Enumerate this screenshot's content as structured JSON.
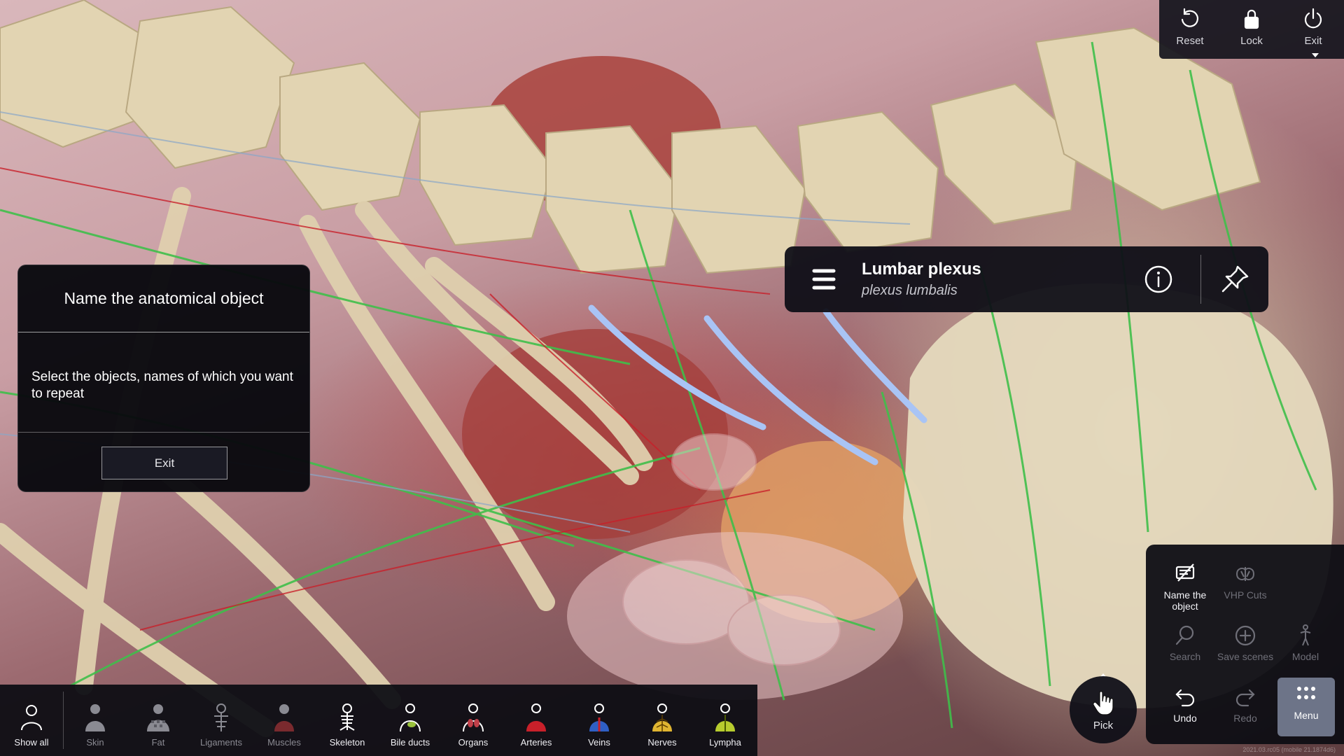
{
  "top_toolbar": {
    "reset_label": "Reset",
    "lock_label": "Lock",
    "exit_label": "Exit"
  },
  "quiz": {
    "title": "Name the anatomical object",
    "instruction": "Select the objects, names of which you want to repeat",
    "exit_label": "Exit"
  },
  "object_label": {
    "name": "Lumbar plexus",
    "latin": "plexus lumbalis"
  },
  "layers": [
    {
      "label": "Show all",
      "icon": "person-outline-icon",
      "state": "on"
    },
    {
      "label": "Skin",
      "icon": "skin-icon",
      "state": "dim"
    },
    {
      "label": "Fat",
      "icon": "fat-icon",
      "state": "dim"
    },
    {
      "label": "Ligaments",
      "icon": "ligaments-icon",
      "state": "dim"
    },
    {
      "label": "Muscles",
      "icon": "muscles-icon",
      "state": "dim"
    },
    {
      "label": "Skeleton",
      "icon": "skeleton-icon",
      "state": "on"
    },
    {
      "label": "Bile ducts",
      "icon": "bile-ducts-icon",
      "state": "on"
    },
    {
      "label": "Organs",
      "icon": "organs-icon",
      "state": "on"
    },
    {
      "label": "Arteries",
      "icon": "arteries-icon",
      "state": "on"
    },
    {
      "label": "Veins",
      "icon": "veins-icon",
      "state": "on"
    },
    {
      "label": "Nerves",
      "icon": "nerves-icon",
      "state": "on"
    },
    {
      "label": "Lympha",
      "icon": "lympha-icon",
      "state": "on"
    }
  ],
  "pick_label": "Pick",
  "menu_panel": {
    "name_object_label": "Name the object",
    "vhp_cuts_label": "VHP Cuts",
    "search_label": "Search",
    "save_scenes_label": "Save scenes",
    "model_label": "Model",
    "undo_label": "Undo",
    "redo_label": "Redo",
    "menu_label": "Menu"
  },
  "version_text": "2021.03.rc05 (mobile 21.1874d6)",
  "colors": {
    "nerve_green": "#3fbf4a",
    "highlight_blue": "#a9c4f5",
    "artery_red": "#c8202a",
    "bone": "#e3d6b8",
    "panel_dark": "#0e0e14",
    "menu_active": "#6d7488"
  }
}
